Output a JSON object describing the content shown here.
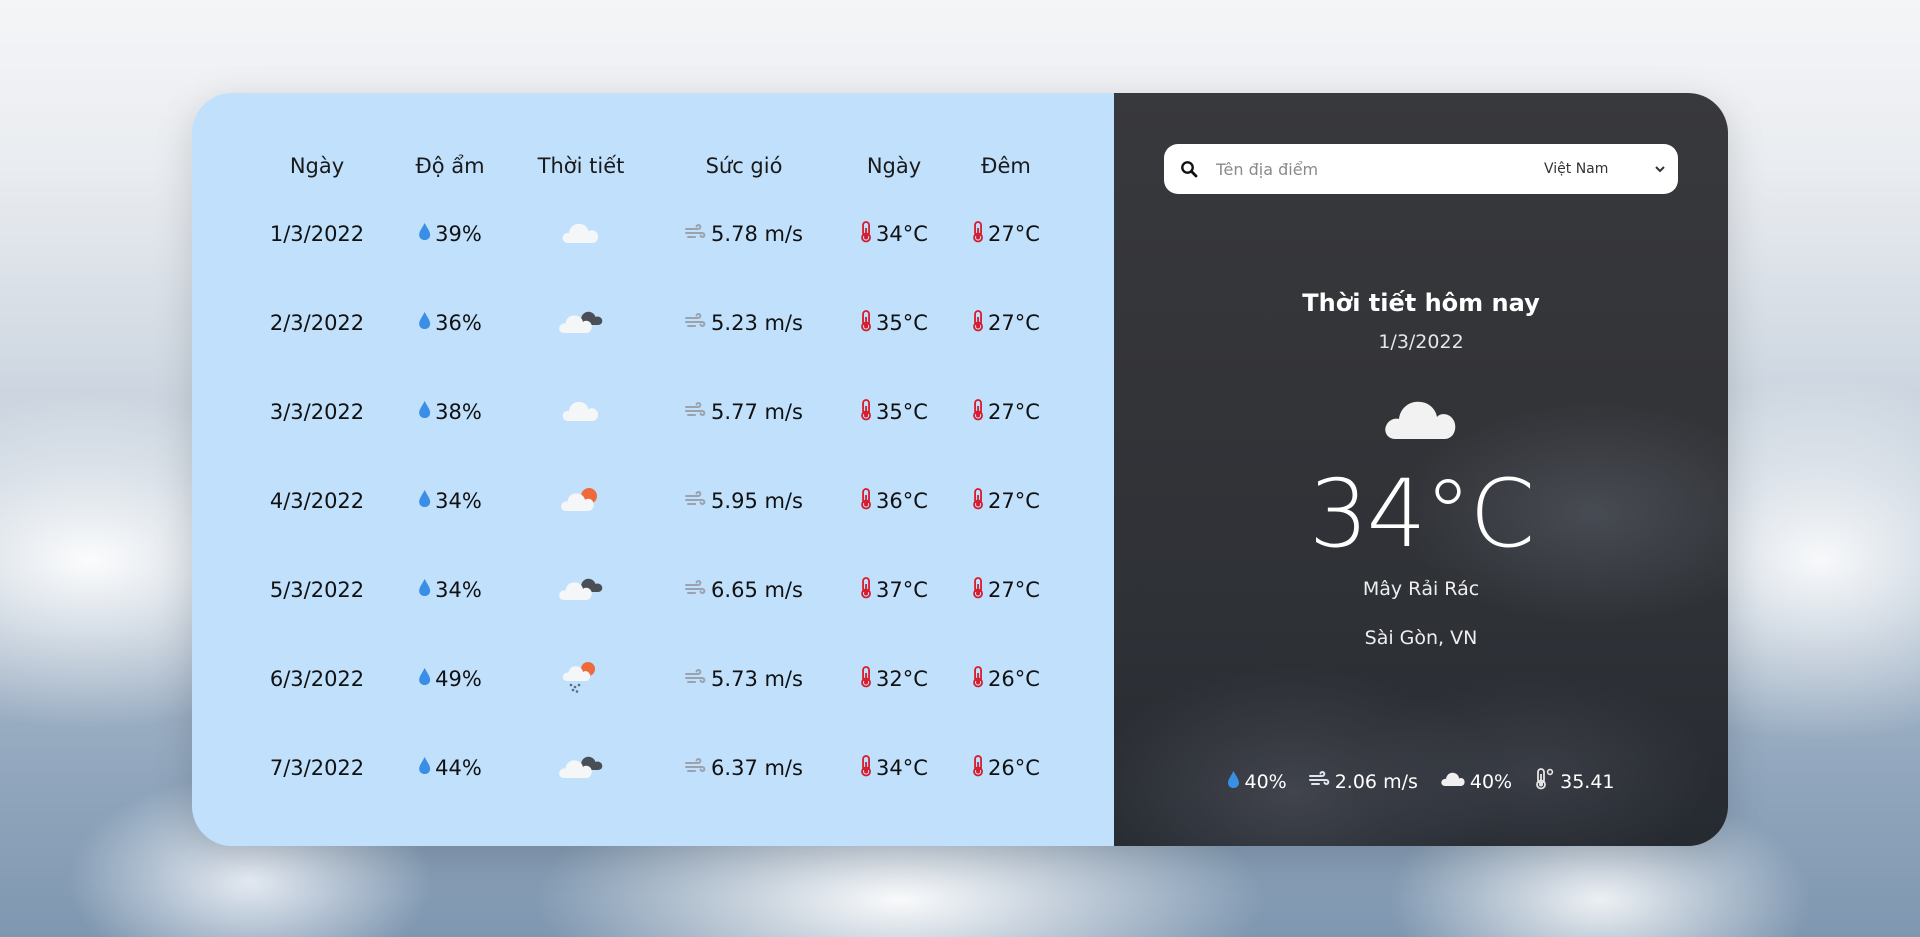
{
  "forecast": {
    "headers": {
      "date": "Ngày",
      "humidity": "Độ ẩm",
      "weather": "Thời tiết",
      "wind": "Sức gió",
      "day": "Ngày",
      "night": "Đêm"
    },
    "rows": [
      {
        "date": "1/3/2022",
        "humidity": "39%",
        "weather_icon": "cloud-icon",
        "wind": "5.78 m/s",
        "day": "34°C",
        "night": "27°C"
      },
      {
        "date": "2/3/2022",
        "humidity": "36%",
        "weather_icon": "broken-clouds-icon",
        "wind": "5.23 m/s",
        "day": "35°C",
        "night": "27°C"
      },
      {
        "date": "3/3/2022",
        "humidity": "38%",
        "weather_icon": "cloud-icon",
        "wind": "5.77 m/s",
        "day": "35°C",
        "night": "27°C"
      },
      {
        "date": "4/3/2022",
        "humidity": "34%",
        "weather_icon": "partly-cloudy-icon",
        "wind": "5.95 m/s",
        "day": "36°C",
        "night": "27°C"
      },
      {
        "date": "5/3/2022",
        "humidity": "34%",
        "weather_icon": "broken-clouds-icon",
        "wind": "6.65 m/s",
        "day": "37°C",
        "night": "27°C"
      },
      {
        "date": "6/3/2022",
        "humidity": "49%",
        "weather_icon": "light-rain-icon",
        "wind": "5.73 m/s",
        "day": "32°C",
        "night": "26°C"
      },
      {
        "date": "7/3/2022",
        "humidity": "44%",
        "weather_icon": "broken-clouds-icon",
        "wind": "6.37 m/s",
        "day": "34°C",
        "night": "26°C"
      }
    ]
  },
  "search": {
    "placeholder": "Tên địa điểm",
    "value": "",
    "country_selected": "Việt Nam"
  },
  "today": {
    "title": "Thời tiết hôm nay",
    "date": "1/3/2022",
    "icon": "cloud-icon",
    "temperature": "34°C",
    "description": "Mây Rải Rác",
    "location": "Sài Gòn, VN",
    "humidity": "40%",
    "wind": "2.06 m/s",
    "clouds": "40%",
    "feels_like": "35.41"
  },
  "colors": {
    "left_panel": "#c0e0fc",
    "right_panel": "#333438",
    "drop_blue": "#3a8ee6",
    "thermo_red": "#d81b2b"
  }
}
